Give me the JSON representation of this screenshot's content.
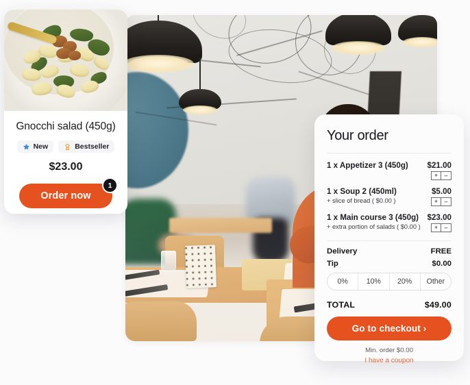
{
  "dish_card": {
    "image_alt": "gnocchi-salad-bowl",
    "title": "Gnocchi salad (450g)",
    "badges": [
      {
        "label": "New",
        "icon": "star-icon",
        "color": "#3b82f6"
      },
      {
        "label": "Bestseller",
        "icon": "medal-icon",
        "color": "#f0a02a"
      }
    ],
    "price": "$23.00",
    "order_button": "Order now",
    "quantity_badge": "1"
  },
  "photo": {
    "alt": "restaurant-interior-with-waiter"
  },
  "order_panel": {
    "title": "Your order",
    "items": [
      {
        "name": "1 x Appetizer 3 (450g)",
        "price": "$21.00",
        "sub": "",
        "plus": "+",
        "minus": "–"
      },
      {
        "name": "1 x Soup 2 (450ml)",
        "price": "$5.00",
        "sub": "+ slice of bread ( $0.00 )",
        "plus": "+",
        "minus": "–"
      },
      {
        "name": "1 x Main course 3 (450g)",
        "price": "$23.00",
        "sub": "+ extra portion of salads ( $0.00 )",
        "plus": "+",
        "minus": "–"
      }
    ],
    "delivery_label": "Delivery",
    "delivery_value": "FREE",
    "tip_label": "Tip",
    "tip_value": "$0.00",
    "tip_options": [
      "0%",
      "10%",
      "20%",
      "Other"
    ],
    "total_label": "TOTAL",
    "total_value": "$49.00",
    "checkout_button": "Go to checkout ›",
    "min_order": "Min. order $0.00",
    "coupon_link": "I have a coupon"
  },
  "theme": {
    "accent": "#e5511f",
    "coupon_color": "#e5653a",
    "badge_new": "#3b82f6",
    "badge_best": "#f0a02a",
    "page_bg": "#fbfbfc"
  }
}
